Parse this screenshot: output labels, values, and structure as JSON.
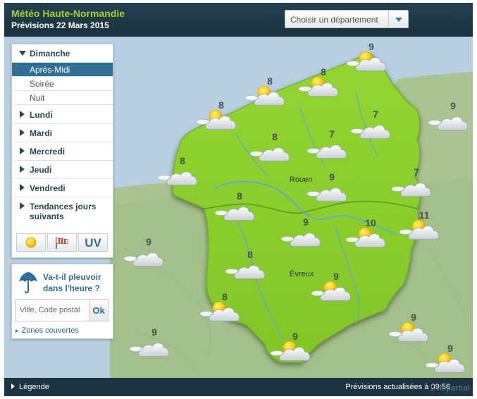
{
  "header": {
    "title": "Météo Haute-Normandie",
    "subtitle": "Prévisions 22 Mars 2015",
    "department_select": "Choisir un département"
  },
  "days": [
    {
      "label": "Dimanche",
      "expanded": true,
      "periods": [
        "Après-Midi",
        "Soirée",
        "Nuit"
      ],
      "selected_period": "Après-Midi"
    },
    {
      "label": "Lundi"
    },
    {
      "label": "Mardi"
    },
    {
      "label": "Mercredi"
    },
    {
      "label": "Jeudi"
    },
    {
      "label": "Vendredi"
    },
    {
      "label": "Tendances jours suivants"
    }
  ],
  "layer_tabs": {
    "sun_icon": "sun-icon",
    "wind_icon": "windsock-icon",
    "uv_label": "UV"
  },
  "rain": {
    "question": "Va-t-il pleuvoir dans l'heure ?",
    "placeholder": "Ville, Code postal",
    "ok_label": "Ok",
    "zones_link": "Zones couvertes"
  },
  "map": {
    "cities": [
      "Rouen",
      "Évreux"
    ],
    "forecasts": [
      {
        "temp": "9",
        "icon": "sun-cloud-icon"
      },
      {
        "temp": "8",
        "icon": "sun-cloud-icon"
      },
      {
        "temp": "8",
        "icon": "sun-cloud-icon"
      },
      {
        "temp": "8",
        "icon": "sun-cloud-icon"
      },
      {
        "temp": "8",
        "icon": "cloud-icon"
      },
      {
        "temp": "7",
        "icon": "cloud-icon"
      },
      {
        "temp": "7",
        "icon": "cloud-icon"
      },
      {
        "temp": "9",
        "icon": "cloud-icon"
      },
      {
        "temp": "8",
        "icon": "cloud-icon"
      },
      {
        "temp": "7",
        "icon": "cloud-icon"
      },
      {
        "temp": "9",
        "icon": "cloud-icon"
      },
      {
        "temp": "8",
        "icon": "cloud-icon"
      },
      {
        "temp": "9",
        "icon": "cloud-icon"
      },
      {
        "temp": "10",
        "icon": "sun-cloud-icon"
      },
      {
        "temp": "11",
        "icon": "sun-cloud-icon"
      },
      {
        "temp": "9",
        "icon": "cloud-icon"
      },
      {
        "temp": "8",
        "icon": "cloud-icon"
      },
      {
        "temp": "9",
        "icon": "sun-cloud-icon"
      },
      {
        "temp": "8",
        "icon": "sun-cloud-icon"
      },
      {
        "temp": "9",
        "icon": "sun-cloud-icon"
      },
      {
        "temp": "9",
        "icon": "cloud-icon"
      },
      {
        "temp": "9",
        "icon": "sun-cloud-icon"
      },
      {
        "temp": "9",
        "icon": "sun-cloud-icon"
      }
    ]
  },
  "footer": {
    "legend_label": "Légende",
    "update_text": "Prévisions actualisées à 09:56",
    "watermark": "L'Impartial"
  },
  "colors": {
    "header_bg": "#1d3443",
    "title_green": "#9fd135",
    "region_green": "#8cd12c",
    "outer_land": "#a9c491",
    "sea": "#b7cfe1",
    "selected_bg": "#2f6f96"
  }
}
